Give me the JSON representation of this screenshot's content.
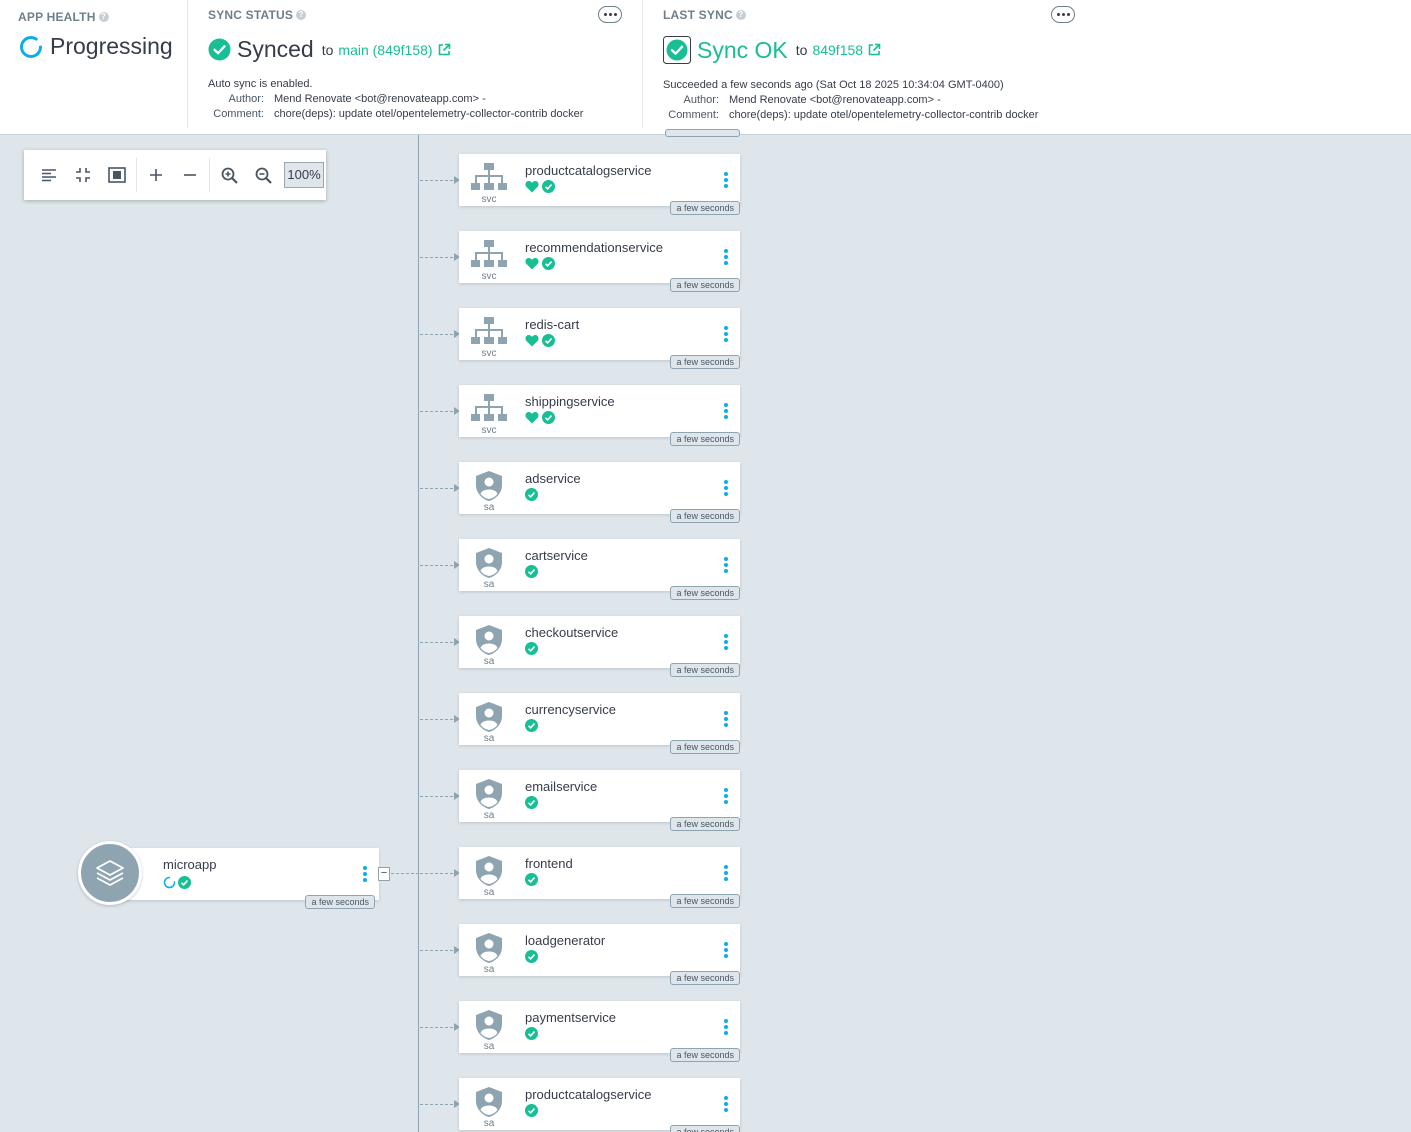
{
  "colors": {
    "accent": "#18be94",
    "link": "#0dadea",
    "progress": "#0dadea",
    "node_icon": "#8fa4b1"
  },
  "app_health": {
    "title": "APP HEALTH",
    "status": "Progressing"
  },
  "sync_status": {
    "title": "SYNC STATUS",
    "status": "Synced",
    "to": "to",
    "revision": "main (849f158)",
    "auto_sync": "Auto sync is enabled.",
    "author_label": "Author:",
    "author": "Mend Renovate <bot@renovateapp.com> -",
    "comment_label": "Comment:",
    "comment": "chore(deps): update otel/opentelemetry-collector-contrib docker"
  },
  "last_sync": {
    "title": "LAST SYNC",
    "status": "Sync OK",
    "to": "to",
    "revision": "849f158",
    "succeeded": "Succeeded a few seconds ago (Sat Oct 18 2025 10:34:04 GMT-0400)",
    "author_label": "Author:",
    "author": "Mend Renovate <bot@renovateapp.com> -",
    "comment_label": "Comment:",
    "comment": "chore(deps): update otel/opentelemetry-collector-contrib docker"
  },
  "toolbar": {
    "zoom": "100%"
  },
  "app_node": {
    "name": "microapp",
    "age": "a few seconds",
    "collapse": "−"
  },
  "nodes": [
    {
      "name": "productcatalogservice",
      "kind": "svc",
      "age": "a few seconds",
      "healthy": true
    },
    {
      "name": "recommendationservice",
      "kind": "svc",
      "age": "a few seconds",
      "healthy": true
    },
    {
      "name": "redis-cart",
      "kind": "svc",
      "age": "a few seconds",
      "healthy": true
    },
    {
      "name": "shippingservice",
      "kind": "svc",
      "age": "a few seconds",
      "healthy": true
    },
    {
      "name": "adservice",
      "kind": "sa",
      "age": "a few seconds",
      "healthy": false
    },
    {
      "name": "cartservice",
      "kind": "sa",
      "age": "a few seconds",
      "healthy": false
    },
    {
      "name": "checkoutservice",
      "kind": "sa",
      "age": "a few seconds",
      "healthy": false
    },
    {
      "name": "currencyservice",
      "kind": "sa",
      "age": "a few seconds",
      "healthy": false
    },
    {
      "name": "emailservice",
      "kind": "sa",
      "age": "a few seconds",
      "healthy": false
    },
    {
      "name": "frontend",
      "kind": "sa",
      "age": "a few seconds",
      "healthy": false
    },
    {
      "name": "loadgenerator",
      "kind": "sa",
      "age": "a few seconds",
      "healthy": false
    },
    {
      "name": "paymentservice",
      "kind": "sa",
      "age": "a few seconds",
      "healthy": false
    },
    {
      "name": "productcatalogservice",
      "kind": "sa",
      "age": "a few seconds",
      "healthy": false
    }
  ]
}
